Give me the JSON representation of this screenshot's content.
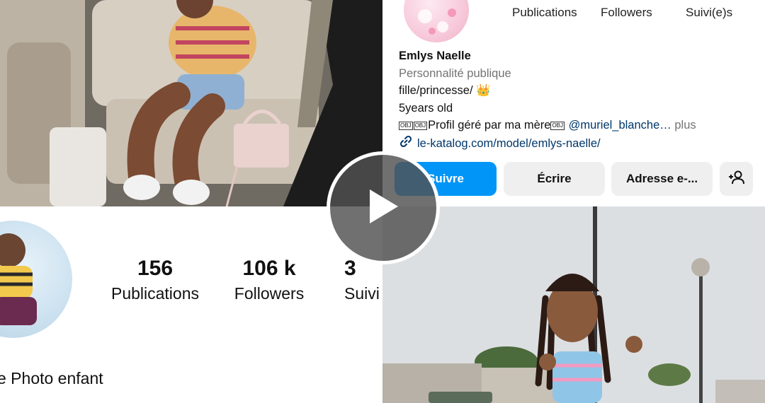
{
  "left_panel": {
    "stats": [
      {
        "value": "156",
        "label": "Publications"
      },
      {
        "value": "106 k",
        "label": "Followers"
      },
      {
        "value": "3",
        "label": "Suivi"
      }
    ],
    "display_name": "e Photo enfant"
  },
  "right_panel": {
    "stat_labels": [
      "Publications",
      "Followers",
      "Suivi(e)s"
    ],
    "bio": {
      "name": "Emlys Naelle",
      "category": "Personnalité publique",
      "line1": "fille/princesse/ 👑",
      "line2": "5years old",
      "line3_prefix": "Profil géré par ma mère",
      "mention": "@muriel_blanche…",
      "more": "plus",
      "link": "le-katalog.com/model/emlys-naelle/"
    },
    "buttons": {
      "follow": "Suivre",
      "message": "Écrire",
      "email": "Adresse e-..."
    }
  },
  "icons": {
    "play": "play-icon",
    "link": "link-icon",
    "add_user": "add-user-icon"
  },
  "colors": {
    "follow_button": "#0095f6",
    "secondary_button": "#efefef",
    "link_text": "#00376b",
    "category_text": "#737373"
  }
}
